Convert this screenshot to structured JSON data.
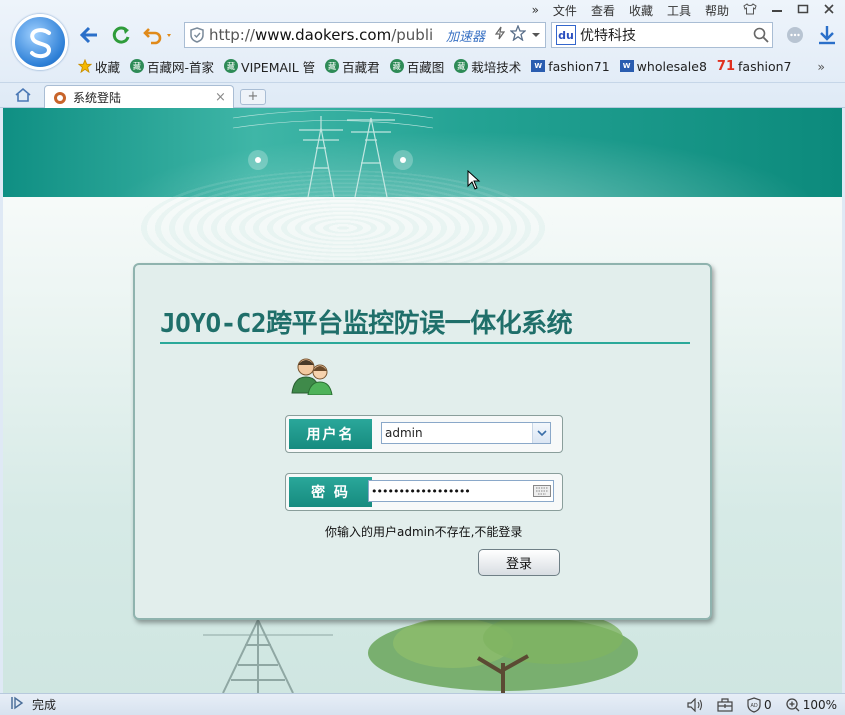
{
  "menubar": {
    "overflow": "»",
    "items": [
      "文件",
      "查看",
      "收藏",
      "工具",
      "帮助"
    ]
  },
  "address": {
    "url_prefix": "http://",
    "url_domain": "www.daokers.com",
    "url_rest": "/publi",
    "accelerator": "加速器"
  },
  "search": {
    "engine_badge": "du",
    "query": "优特科技"
  },
  "bookmarks": {
    "favorites_label": "收藏",
    "items": [
      "百藏网-首家",
      "VIPEMAIL 管",
      "百藏君",
      "百藏图",
      "栽培技术",
      "fashion71",
      "wholesale8",
      "fashion7"
    ],
    "overflow": "»"
  },
  "tab": {
    "title": "系统登陆",
    "close": "×",
    "new_tab": "+"
  },
  "login": {
    "system_title": "JOYO-C2跨平台监控防误一体化系统",
    "username_label": "用户名",
    "username_value": "admin",
    "password_label": "密 码",
    "password_value": "••••••••••••••••••",
    "error_message": "你输入的用户admin不存在,不能登录",
    "login_button": "登录"
  },
  "status": {
    "text": "完成",
    "adblock_count": "0",
    "zoom": "100%"
  },
  "colors": {
    "accent_teal": "#1f6f6a",
    "label_bg": "#1a9487",
    "banner": "#24a394"
  }
}
